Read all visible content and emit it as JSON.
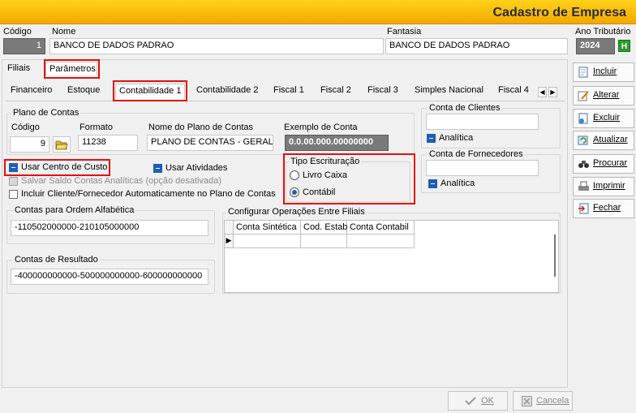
{
  "window": {
    "title": "Cadastro de Empresa"
  },
  "header": {
    "codigo_label": "Código",
    "codigo_value": "1",
    "nome_label": "Nome",
    "nome_value": "BANCO DE DADOS PADRAO",
    "fantasia_label": "Fantasia",
    "fantasia_value": "BANCO DE DADOS PADRAO",
    "ano_label": "Ano Tributário",
    "ano_value": "2024",
    "ano_btn": "H"
  },
  "top_tabs": [
    "Filiais",
    "Parâmetros"
  ],
  "sub_tabs": [
    "Financeiro",
    "Estoque",
    "Contabilidade 1",
    "Contabilidade 2",
    "Fiscal 1",
    "Fiscal 2",
    "Fiscal 3",
    "Simples Nacional",
    "Fiscal 4"
  ],
  "plano": {
    "title": "Plano de Contas",
    "codigo_label": "Código",
    "codigo_value": "9",
    "formato_label": "Formato",
    "formato_value": "11238",
    "nome_label": "Nome do Plano de Contas",
    "nome_value": "PLANO DE CONTAS - GERAL",
    "exemplo_label": "Exemplo de Conta",
    "exemplo_value": "0.0.00.000.00000000"
  },
  "clientes": {
    "title": "Conta de Clientes",
    "value": "",
    "analitica": "Analítica"
  },
  "fornecedores": {
    "title": "Conta de Fornecedores",
    "value": "",
    "analitica": "Analítica"
  },
  "options": {
    "usar_centro": "Usar Centro de Custo",
    "usar_atividades": "Usar Atividades",
    "salvar_saldo": "Salvar Saldo  Contas Analíticas (opção desativada)",
    "incluir_cliente": "Incluir Cliente/Fornecedor Automaticamente no Plano de Contas"
  },
  "escrituracao": {
    "title": "Tipo Escrituração",
    "livro": "Livro Caixa",
    "contabil": "Contábil"
  },
  "contas_alfa": {
    "title": "Contas para Ordem  Alfabética",
    "value": "-110502000000-210105000000"
  },
  "contas_resultado": {
    "title": "Contas de Resultado",
    "value": "-400000000000-500000000000-600000000000"
  },
  "operacoes": {
    "title": "Configurar Operações Entre Filiais",
    "columns": [
      "Conta Sintética",
      "Cod. Estab",
      "Conta Contabil"
    ]
  },
  "toolbar": {
    "incluir": "Incluir",
    "alterar": "Alterar",
    "excluir": "Excluir",
    "atualizar": "Atualizar",
    "procurar": "Procurar",
    "imprimir": "Imprimir",
    "fechar": "Fechar"
  },
  "footer": {
    "ok": "OK",
    "cancela": "Cancela"
  }
}
